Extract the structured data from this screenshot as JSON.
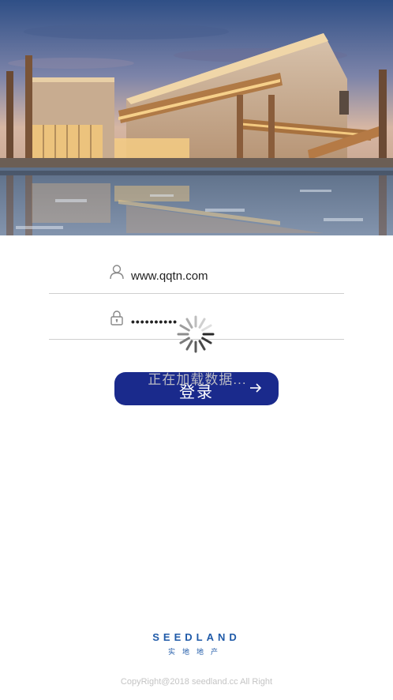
{
  "login_form": {
    "username_value": "www.qqtn.com",
    "password_value": "••••••••••",
    "login_label": "登录"
  },
  "loading": {
    "text": "正在加载数据..."
  },
  "brand": {
    "logo_text": "SEEDLAND",
    "logo_subtext": "实 地 地 产"
  },
  "footer": {
    "copyright": "CopyRight@2018 seedland.cc All Right"
  },
  "colors": {
    "primary": "#1a2a8c",
    "brand_blue": "#1f5aa8",
    "divider": "#cfcfcf"
  },
  "icons": {
    "user": "user-icon",
    "lock": "lock-icon",
    "arrow": "arrow-right-icon",
    "spinner": "loading-spinner"
  }
}
